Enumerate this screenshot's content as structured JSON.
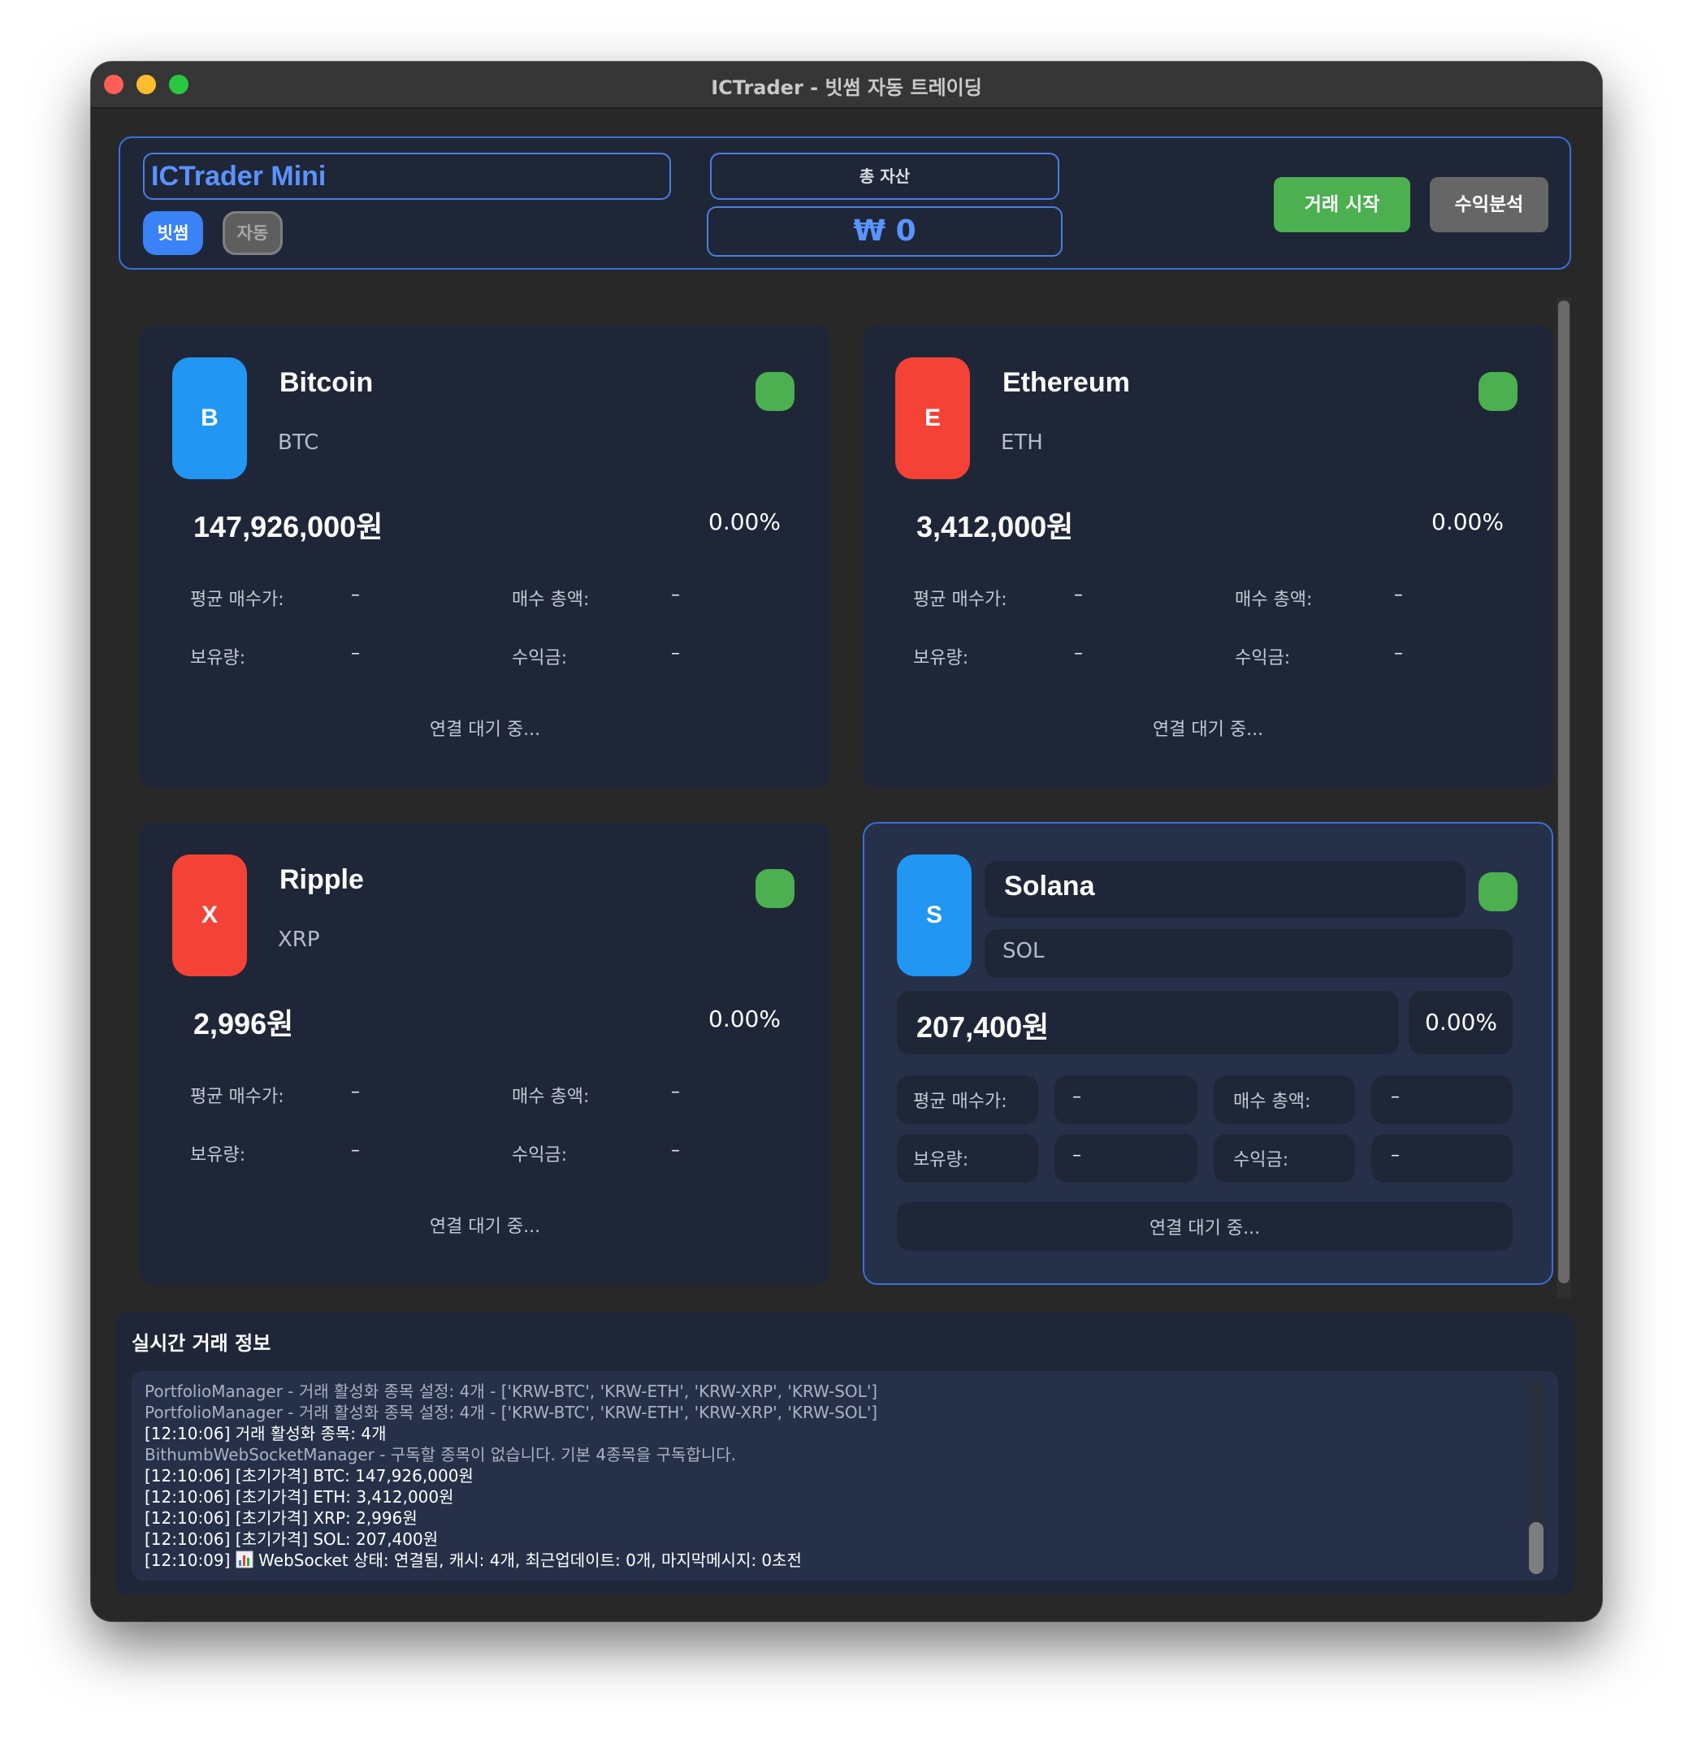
{
  "window": {
    "title": "ICTrader - 빗썸 자동 트레이딩"
  },
  "header": {
    "app_title": "ICTrader Mini",
    "chip_exchange": "빗썸",
    "chip_auto": "자동",
    "total_asset_label": "총 자산",
    "total_asset_value": "₩ 0",
    "start_button": "거래 시작",
    "profit_button": "수익분석"
  },
  "labels": {
    "avg_buy_price": "평균 매수가:",
    "total_buy": "매수 총액:",
    "holdings": "보유량:",
    "profit": "수익금:",
    "dash": "–",
    "connection": "연결 대기 중..."
  },
  "coins": [
    {
      "badge": "B",
      "name": "Bitcoin",
      "symbol": "BTC",
      "price": "147,926,000원",
      "change": "0.00%",
      "badge_color": "#2196f3"
    },
    {
      "badge": "E",
      "name": "Ethereum",
      "symbol": "ETH",
      "price": "3,412,000원",
      "change": "0.00%",
      "badge_color": "#f44336"
    },
    {
      "badge": "X",
      "name": "Ripple",
      "symbol": "XRP",
      "price": "2,996원",
      "change": "0.00%",
      "badge_color": "#f44336"
    },
    {
      "badge": "S",
      "name": "Solana",
      "symbol": "SOL",
      "price": "207,400원",
      "change": "0.00%",
      "badge_color": "#2196f3"
    }
  ],
  "log": {
    "title": "실시간 거래 정보",
    "lines": [
      "PortfolioManager - 거래 활성화 종목 설정: 4개 - ['KRW-BTC', 'KRW-ETH', 'KRW-XRP', 'KRW-SOL']",
      "PortfolioManager - 거래 활성화 종목 설정: 4개 - ['KRW-BTC', 'KRW-ETH', 'KRW-XRP', 'KRW-SOL']",
      "[12:10:06] 거래 활성화 종목: 4개",
      "BithumbWebSocketManager - 구독할 종목이 없습니다. 기본 4종목을 구독합니다.",
      "[12:10:06] [초기가격] BTC: 147,926,000원",
      "[12:10:06] [초기가격] ETH: 3,412,000원",
      "[12:10:06] [초기가격] XRP: 2,996원",
      "[12:10:06] [초기가격] SOL: 207,400원"
    ],
    "last_line_time": "[12:10:09]",
    "last_line_icon": "bar-chart-icon",
    "last_line_text": "WebSocket 상태: 연결됨, 캐시: 4개, 최근업데이트: 0개, 마지막메시지: 0초전"
  },
  "colors": {
    "accent": "#3b82f6",
    "status_green": "#4caf50",
    "panel": "#1f2637",
    "selected_card": "#263048"
  }
}
